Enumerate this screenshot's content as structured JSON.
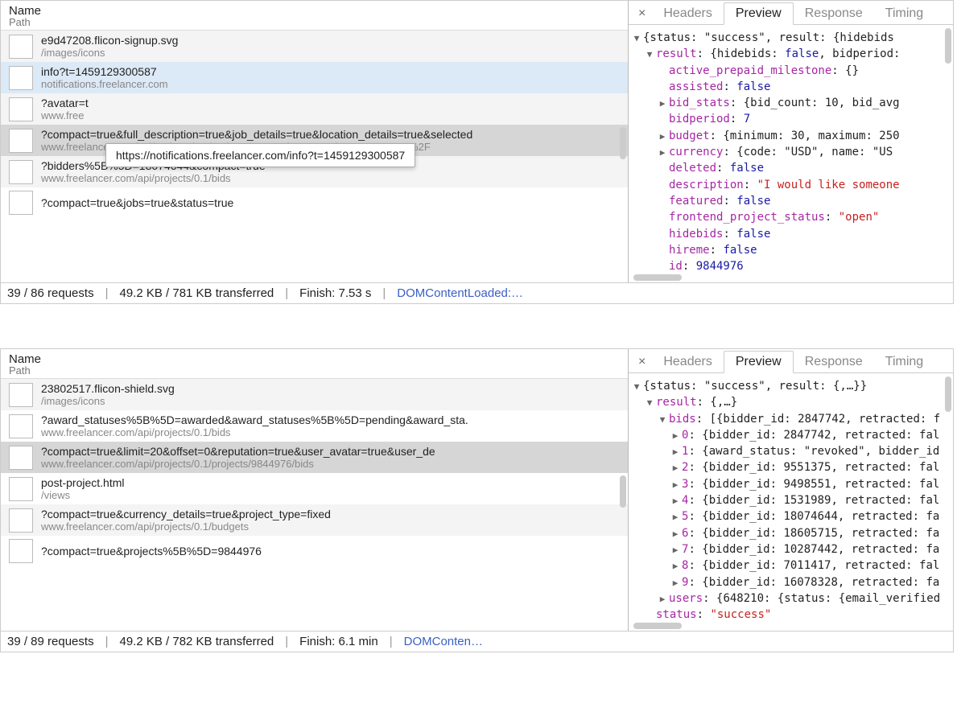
{
  "panes": [
    {
      "columns": {
        "name": "Name",
        "path": "Path"
      },
      "requests": [
        {
          "name": "e9d47208.flicon-signup.svg",
          "path": "/images/icons",
          "state": "alt"
        },
        {
          "name": "info?t=1459129300587",
          "path": "notifications.freelancer.com",
          "state": "highlight"
        },
        {
          "name": "?avatar=t",
          "path": "www.free",
          "state": "alt"
        },
        {
          "name": "?compact=true&full_description=true&job_details=true&location_details=true&selected",
          "path": "www.freelancer.com/api/projects/0.1/projects/Javascript%2FWeb-Page-Scraper%2F",
          "state": "selected"
        },
        {
          "name": "?bidders%5B%5D=18074644&compact=true",
          "path": "www.freelancer.com/api/projects/0.1/bids",
          "state": "alt"
        },
        {
          "name": "?compact=true&jobs=true&status=true",
          "path": "",
          "state": ""
        }
      ],
      "tooltip": "https://notifications.freelancer.com/info?t=1459129300587",
      "status": {
        "requests": "39 / 86 requests",
        "transferred": "49.2 KB / 781 KB transferred",
        "finish": "Finish: 7.53 s",
        "dom": "DOMContentLoaded:…"
      },
      "tabs": {
        "close": "×",
        "items": [
          "Headers",
          "Preview",
          "Response",
          "Timing"
        ],
        "active": 1
      },
      "preview_header": "{status: \"success\", result: {hidebids",
      "preview": [
        {
          "indent": 1,
          "tri": "down",
          "raw": "<span class='key'>result</span><span class='plain'>: {hidebids: </span><span class='kw'>false</span><span class='plain'>, bidperiod:</span>"
        },
        {
          "indent": 2,
          "tri": "none",
          "raw": "<span class='key'>active_prepaid_milestone</span><span class='plain'>: {}</span>"
        },
        {
          "indent": 2,
          "tri": "none",
          "raw": "<span class='key'>assisted</span><span class='plain'>: </span><span class='kw'>false</span>"
        },
        {
          "indent": 2,
          "tri": "right",
          "raw": "<span class='key'>bid_stats</span><span class='plain'>: {bid_count: 10, bid_avg</span>"
        },
        {
          "indent": 2,
          "tri": "none",
          "raw": "<span class='key'>bidperiod</span><span class='plain'>: </span><span class='num'>7</span>"
        },
        {
          "indent": 2,
          "tri": "right",
          "raw": "<span class='key'>budget</span><span class='plain'>: {minimum: 30, maximum: 250</span>"
        },
        {
          "indent": 2,
          "tri": "right",
          "raw": "<span class='key'>currency</span><span class='plain'>: {code: \"USD\", name: \"US</span>"
        },
        {
          "indent": 2,
          "tri": "none",
          "raw": "<span class='key'>deleted</span><span class='plain'>: </span><span class='kw'>false</span>"
        },
        {
          "indent": 2,
          "tri": "none",
          "raw": "<span class='key'>description</span><span class='plain'>: </span><span class='str'>\"I would like someone</span>"
        },
        {
          "indent": 2,
          "tri": "none",
          "raw": "<span class='key'>featured</span><span class='plain'>: </span><span class='kw'>false</span>"
        },
        {
          "indent": 2,
          "tri": "none",
          "raw": "<span class='key'>frontend_project_status</span><span class='plain'>: </span><span class='str'>\"open\"</span>"
        },
        {
          "indent": 2,
          "tri": "none",
          "raw": "<span class='key'>hidebids</span><span class='plain'>: </span><span class='kw'>false</span>"
        },
        {
          "indent": 2,
          "tri": "none",
          "raw": "<span class='key'>hireme</span><span class='plain'>: </span><span class='kw'>false</span>"
        },
        {
          "indent": 2,
          "tri": "none",
          "raw": "<span class='key'>id</span><span class='plain'>: </span><span class='num'>9844976</span>"
        }
      ]
    },
    {
      "columns": {
        "name": "Name",
        "path": "Path"
      },
      "requests": [
        {
          "name": "23802517.flicon-shield.svg",
          "path": "/images/icons",
          "state": "alt"
        },
        {
          "name": "?award_statuses%5B%5D=awarded&award_statuses%5B%5D=pending&award_sta.",
          "path": "www.freelancer.com/api/projects/0.1/bids",
          "state": ""
        },
        {
          "name": "?compact=true&limit=20&offset=0&reputation=true&user_avatar=true&user_de",
          "path": "www.freelancer.com/api/projects/0.1/projects/9844976/bids",
          "state": "selected"
        },
        {
          "name": "post-project.html",
          "path": "/views",
          "state": ""
        },
        {
          "name": "?compact=true&currency_details=true&project_type=fixed",
          "path": "www.freelancer.com/api/projects/0.1/budgets",
          "state": "alt"
        },
        {
          "name": "?compact=true&projects%5B%5D=9844976",
          "path": "",
          "state": ""
        }
      ],
      "tooltip": "",
      "status": {
        "requests": "39 / 89 requests",
        "transferred": "49.2 KB / 782 KB transferred",
        "finish": "Finish: 6.1 min",
        "dom": "DOMConten…"
      },
      "tabs": {
        "close": "×",
        "items": [
          "Headers",
          "Preview",
          "Response",
          "Timing"
        ],
        "active": 1
      },
      "preview_header": "{status: \"success\", result: {,…}}",
      "preview": [
        {
          "indent": 1,
          "tri": "down",
          "raw": "<span class='key'>result</span><span class='plain'>: {,…}</span>"
        },
        {
          "indent": 2,
          "tri": "down",
          "raw": "<span class='key'>bids</span><span class='plain'>: [{bidder_id: 2847742, retracted: f</span>"
        },
        {
          "indent": 3,
          "tri": "right",
          "raw": "<span class='key'>0</span><span class='plain'>: {bidder_id: 2847742, retracted: fal</span>"
        },
        {
          "indent": 3,
          "tri": "right",
          "raw": "<span class='key'>1</span><span class='plain'>: {award_status: \"revoked\", bidder_id</span>"
        },
        {
          "indent": 3,
          "tri": "right",
          "raw": "<span class='key'>2</span><span class='plain'>: {bidder_id: 9551375, retracted: fal</span>"
        },
        {
          "indent": 3,
          "tri": "right",
          "raw": "<span class='key'>3</span><span class='plain'>: {bidder_id: 9498551, retracted: fal</span>"
        },
        {
          "indent": 3,
          "tri": "right",
          "raw": "<span class='key'>4</span><span class='plain'>: {bidder_id: 1531989, retracted: fal</span>"
        },
        {
          "indent": 3,
          "tri": "right",
          "raw": "<span class='key'>5</span><span class='plain'>: {bidder_id: 18074644, retracted: fa</span>"
        },
        {
          "indent": 3,
          "tri": "right",
          "raw": "<span class='key'>6</span><span class='plain'>: {bidder_id: 18605715, retracted: fa</span>"
        },
        {
          "indent": 3,
          "tri": "right",
          "raw": "<span class='key'>7</span><span class='plain'>: {bidder_id: 10287442, retracted: fa</span>"
        },
        {
          "indent": 3,
          "tri": "right",
          "raw": "<span class='key'>8</span><span class='plain'>: {bidder_id: 7011417, retracted: fal</span>"
        },
        {
          "indent": 3,
          "tri": "right",
          "raw": "<span class='key'>9</span><span class='plain'>: {bidder_id: 16078328, retracted: fa</span>"
        },
        {
          "indent": 2,
          "tri": "right",
          "raw": "<span class='key'>users</span><span class='plain'>: {648210: {status: {email_verified</span>"
        },
        {
          "indent": 1,
          "tri": "none",
          "raw": "<span class='key'>status</span><span class='plain'>: </span><span class='str'>\"success\"</span>"
        }
      ]
    }
  ]
}
